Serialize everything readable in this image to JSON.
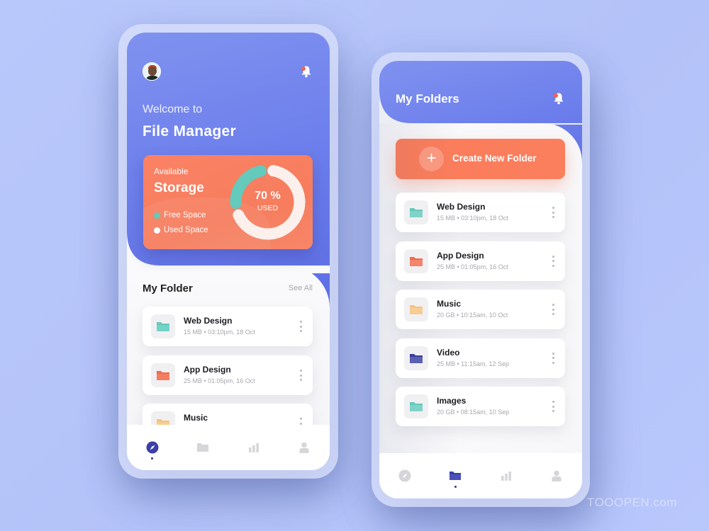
{
  "colors": {
    "primary_blue": "#6a7cea",
    "accent_orange": "#fa7d5e",
    "teal": "#63cabc",
    "folder_yellow": "#f6c37e",
    "folder_navy": "#383ea0",
    "active_nav": "#3b3fa6",
    "inactive_nav": "#d6d6da"
  },
  "home_screen": {
    "header": {
      "avatar_icon": "user-avatar",
      "notification_icon": "bell-icon",
      "welcome_text": "Welcome to",
      "app_title": "File Manager"
    },
    "storage_card": {
      "label": "Available",
      "title": "Storage",
      "used_percent": 70,
      "percent_label": "70 %",
      "percent_sublabel": "USED",
      "legend": [
        {
          "label": "Free Space",
          "color": "#63cabc"
        },
        {
          "label": "Used Space",
          "color": "#ffffff"
        }
      ]
    },
    "section": {
      "title": "My Folder",
      "see_all": "See All"
    },
    "folders": [
      {
        "name": "Web Design",
        "meta": "15 MB • 03:10pm, 18 Oct",
        "color": "#63cabc"
      },
      {
        "name": "App Design",
        "meta": "25 MB • 01:05pm, 16 Oct",
        "color": "#f26a4b"
      },
      {
        "name": "Music",
        "meta": "",
        "color": "#f6c37e"
      }
    ],
    "bottom_nav": [
      {
        "icon": "compass-icon",
        "active": true
      },
      {
        "icon": "folder-icon",
        "active": false
      },
      {
        "icon": "chart-icon",
        "active": false
      },
      {
        "icon": "user-icon",
        "active": false
      }
    ]
  },
  "folders_screen": {
    "header": {
      "title": "My Folders",
      "notification_icon": "bell-icon"
    },
    "create_button": {
      "icon": "plus-icon",
      "plus_glyph": "+",
      "label": "Create New Folder"
    },
    "folders": [
      {
        "name": "Web Design",
        "meta": "15 MB • 03:10pm, 18 Oct",
        "color": "#63cabc"
      },
      {
        "name": "App Design",
        "meta": "25 MB • 01:05pm, 16 Oct",
        "color": "#f26a4b"
      },
      {
        "name": "Music",
        "meta": "20 GB • 10:15am, 10 Oct",
        "color": "#f6c37e"
      },
      {
        "name": "Video",
        "meta": "25 MB • 11:15am, 12 Sep",
        "color": "#383ea0"
      },
      {
        "name": "Images",
        "meta": "20 GB • 08:15am, 10 Sep",
        "color": "#63cabc"
      }
    ],
    "bottom_nav": [
      {
        "icon": "compass-icon",
        "active": false
      },
      {
        "icon": "folder-icon",
        "active": true
      },
      {
        "icon": "chart-icon",
        "active": false
      },
      {
        "icon": "user-icon",
        "active": false
      }
    ]
  },
  "watermark": "TOOOPEN.com"
}
